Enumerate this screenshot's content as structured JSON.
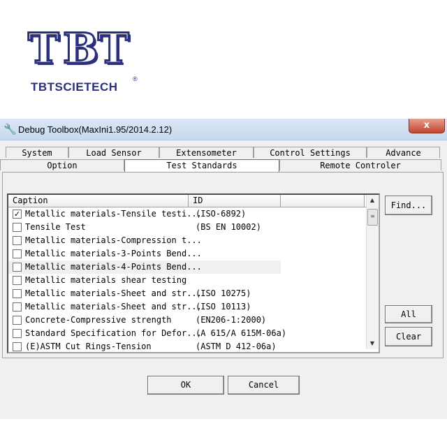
{
  "logo": {
    "letters": [
      "T",
      "B",
      "T"
    ],
    "name": "TBTSCIETECH",
    "registered": "®"
  },
  "window": {
    "title": "Debug Toolbox(MaxIni1.95/2014.2.12)",
    "close_glyph": "x",
    "app_icon": "wrench-icon"
  },
  "tabs": {
    "row1": [
      "System",
      "Load Sensor",
      "Extensometer",
      "Control Settings",
      "Advance"
    ],
    "row2": [
      "Option",
      "Test Standards",
      "Remote Controler"
    ],
    "active": "Test Standards"
  },
  "list": {
    "columns": [
      "Caption",
      "ID",
      ""
    ],
    "rows": [
      {
        "checked": true,
        "caption": "Metallic materials-Tensile testi...",
        "id": "(ISO-6892)"
      },
      {
        "checked": false,
        "caption": "Tensile Test",
        "id": "(BS EN 10002)"
      },
      {
        "checked": false,
        "caption": "Metallic materials-Compression t...",
        "id": ""
      },
      {
        "checked": false,
        "caption": "Metallic materials-3-Points Bend...",
        "id": ""
      },
      {
        "checked": false,
        "caption": "Metallic materials-4-Points Bend...",
        "id": ""
      },
      {
        "checked": false,
        "caption": "Metallic materials shear testing",
        "id": ""
      },
      {
        "checked": false,
        "caption": "Metallic materials-Sheet and str...",
        "id": "(ISO 10275)"
      },
      {
        "checked": false,
        "caption": "Metallic materials-Sheet and str...",
        "id": "(ISO 10113)"
      },
      {
        "checked": false,
        "caption": "Concrete-Compressive strength",
        "id": "(EN206-1:2000)"
      },
      {
        "checked": false,
        "caption": "Standard Specification for Defor...",
        "id": "(A 615/A 615M-06a)"
      },
      {
        "checked": false,
        "caption": "(E)ASTM Cut Rings-Tension",
        "id": "(ASTM D 412-06a)"
      }
    ],
    "highlighted_row": 4
  },
  "buttons": {
    "find": "Find...",
    "all": "All",
    "clear": "Clear",
    "ok": "OK",
    "cancel": "Cancel"
  },
  "colors": {
    "logo": "#2a2f7e",
    "titlebar": "#c8d9ee",
    "close": "#c4452f",
    "dialog": "#f0f0f0"
  }
}
